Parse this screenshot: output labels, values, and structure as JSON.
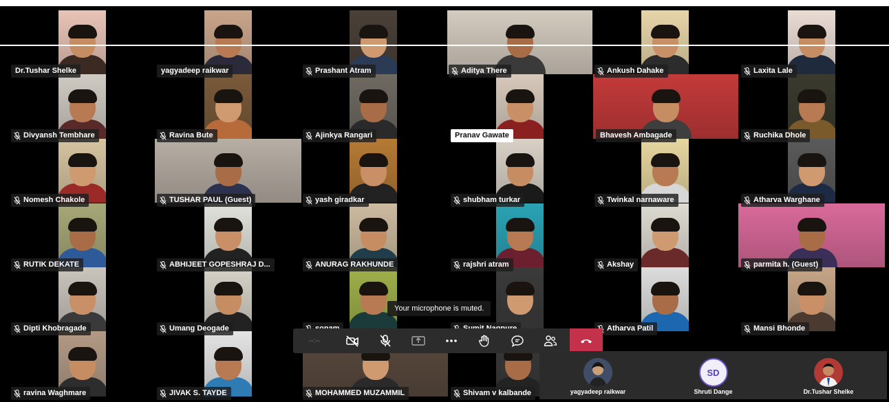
{
  "meeting": {
    "toast": "Your microphone is muted.",
    "timer": "--:--",
    "colors": {
      "hangup": "#c4314b",
      "bar": "#2d2c2c",
      "label_bg": "#1e1e1e"
    }
  },
  "participants": [
    {
      "name": "Dr.Tushar Shelke",
      "mic": false
    },
    {
      "name": "yagyadeep raikwar",
      "mic": false
    },
    {
      "name": "Prashant Atram",
      "mic": true
    },
    {
      "name": "Aditya There",
      "mic": true
    },
    {
      "name": "Ankush Dahake",
      "mic": true
    },
    {
      "name": "Laxita Lale",
      "mic": true
    },
    {
      "name": "Divyansh Tembhare",
      "mic": true
    },
    {
      "name": "Ravina Bute",
      "mic": true
    },
    {
      "name": "Ajinkya Rangari",
      "mic": true
    },
    {
      "name": "Pranav Gawate",
      "mic": false
    },
    {
      "name": "Bhavesh Ambagade",
      "mic": false
    },
    {
      "name": "Ruchika Dhole",
      "mic": true
    },
    {
      "name": "Nomesh Chakole",
      "mic": true
    },
    {
      "name": "TUSHAR PAUL (Guest)",
      "mic": true
    },
    {
      "name": "yash giradkar",
      "mic": true
    },
    {
      "name": "shubham turkar",
      "mic": true
    },
    {
      "name": "Twinkal narnaware",
      "mic": true
    },
    {
      "name": "Atharva Warghane",
      "mic": true
    },
    {
      "name": "RUTIK DEKATE",
      "mic": true
    },
    {
      "name": "ABHIJEET GOPESHRAJ D...",
      "mic": true
    },
    {
      "name": "ANURAG RAKHUNDE",
      "mic": true
    },
    {
      "name": "rajshri atram",
      "mic": true
    },
    {
      "name": "Akshay",
      "mic": true
    },
    {
      "name": "parmita h. (Guest)",
      "mic": true
    },
    {
      "name": "Dipti Khobragade",
      "mic": true
    },
    {
      "name": "Umang Deogade",
      "mic": true
    },
    {
      "name": "sonam",
      "mic": true
    },
    {
      "name": "Sumit Nagpure",
      "mic": true
    },
    {
      "name": "Atharva Patil",
      "mic": true
    },
    {
      "name": "Mansi Bhonde",
      "mic": true
    },
    {
      "name": "ravina Waghmare",
      "mic": true
    },
    {
      "name": "JIVAK S. TAYDE",
      "mic": true
    },
    {
      "name": "MOHAMMED MUZAMMIL",
      "mic": true
    },
    {
      "name": "Shivam v kalbande",
      "mic": true
    }
  ],
  "roster": [
    {
      "name": "yagyadeep raikwar",
      "icon": "photo-avatar"
    },
    {
      "name": "Shruti Dange",
      "initials": "SD"
    },
    {
      "name": "Dr.Tushar Shelke",
      "icon": "photo-avatar"
    }
  ],
  "controls": [
    {
      "name": "camera-off-icon"
    },
    {
      "name": "mic-off-icon"
    },
    {
      "name": "share-screen-icon"
    },
    {
      "name": "more-actions-icon"
    },
    {
      "name": "raise-hand-icon"
    },
    {
      "name": "chat-icon"
    },
    {
      "name": "participants-icon"
    },
    {
      "name": "hang-up-icon"
    }
  ]
}
